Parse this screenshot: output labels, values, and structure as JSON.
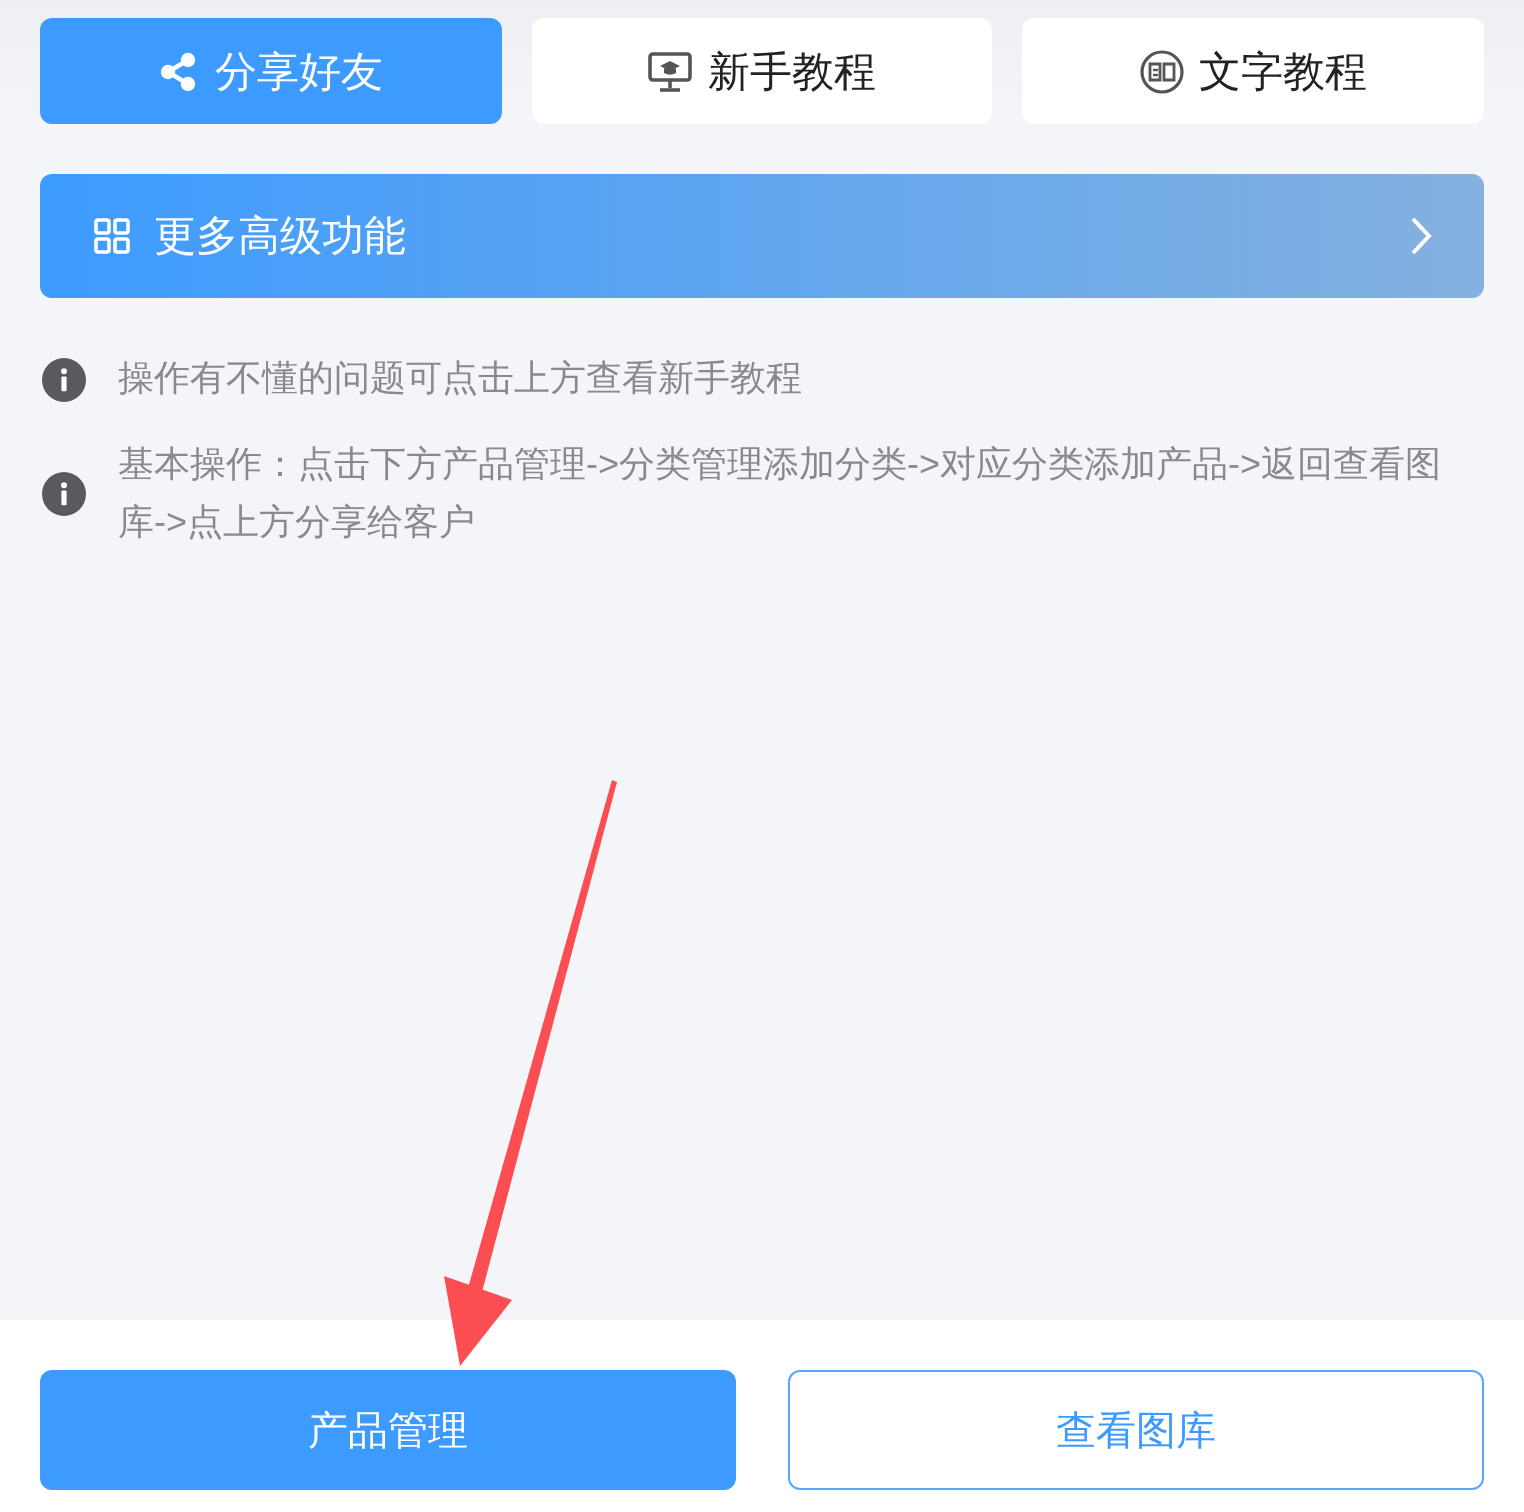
{
  "top_buttons": [
    {
      "label": "分享好友",
      "kind": "primary"
    },
    {
      "label": "新手教程",
      "kind": "plain"
    },
    {
      "label": "文字教程",
      "kind": "plain"
    }
  ],
  "banner": {
    "label": "更多高级功能"
  },
  "tips": [
    "操作有不懂的问题可点击上方查看新手教程",
    "基本操作：点击下方产品管理->分类管理添加分类->对应分类添加产品->返回查看图库->点上方分享给客户"
  ],
  "bottom_buttons": [
    {
      "label": "产品管理",
      "kind": "primary"
    },
    {
      "label": "查看图库",
      "kind": "outline"
    }
  ]
}
